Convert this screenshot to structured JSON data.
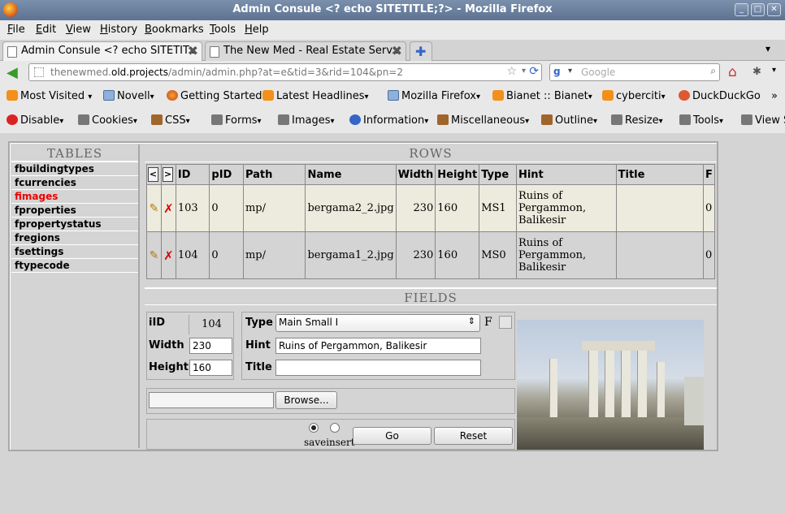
{
  "window": {
    "title": "Admin Consule <? echo SITETITLE;?> - Mozilla Firefox"
  },
  "menu": [
    "File",
    "Edit",
    "View",
    "History",
    "Bookmarks",
    "Tools",
    "Help"
  ],
  "tabs": [
    {
      "label": "Admin Consule <? echo SITETIT..."
    },
    {
      "label": "The New Med - Real Estate Serv..."
    }
  ],
  "nav": {
    "url_prefix": "thenewmed.",
    "url_host": "old.projects",
    "url_rest": "/admin/admin.php?at=e&tid=3&rid=104&pn=2",
    "search_placeholder": "Google"
  },
  "bookmarks": [
    "Most Visited",
    "Novell",
    "Getting Started",
    "Latest Headlines",
    "Mozilla Firefox",
    "Bianet :: Bianet",
    "cyberciti",
    "DuckDuckGo"
  ],
  "webdev": [
    "Disable",
    "Cookies",
    "CSS",
    "Forms",
    "Images",
    "Information",
    "Miscellaneous",
    "Outline",
    "Resize",
    "Tools",
    "View S"
  ],
  "tables": {
    "header": "TABLES",
    "items": [
      "fbuildingtypes",
      "fcurrencies",
      "fimages",
      "fproperties",
      "fpropertystatus",
      "fregions",
      "fsettings",
      "ftypecode"
    ],
    "active": "fimages"
  },
  "rows": {
    "header": "ROWS",
    "prev": "<",
    "next": ">",
    "columns": [
      "ID",
      "pID",
      "Path",
      "Name",
      "Width",
      "Height",
      "Type",
      "Hint",
      "Title",
      "F"
    ],
    "data": [
      {
        "id": "103",
        "pid": "0",
        "path": "mp/",
        "name": "bergama2_2.jpg",
        "width": "230",
        "height": "160",
        "type": "MS1",
        "hint_l1": "Ruins of",
        "hint_l2": "Pergammon,",
        "hint_l3": "Balikesir",
        "title": "",
        "f": "0"
      },
      {
        "id": "104",
        "pid": "0",
        "path": "mp/",
        "name": "bergama1_2.jpg",
        "width": "230",
        "height": "160",
        "type": "MS0",
        "hint_l1": "Ruins of",
        "hint_l2": "Pergammon,",
        "hint_l3": "Balikesir",
        "title": "",
        "f": "0"
      }
    ]
  },
  "fields": {
    "header": "FIELDS",
    "iid_label": "iID",
    "iid_value": "104",
    "type_label": "Type",
    "type_value": "Main Small I",
    "f_label": "F",
    "width_label": "Width",
    "width_value": "230",
    "hint_label": "Hint",
    "hint_value": "Ruins of Pergammon, Balikesir",
    "height_label": "Height",
    "height_value": "160",
    "title_label": "Title",
    "title_value": "",
    "browse_label": "Browse...",
    "save_label": "save",
    "insert_label": "insert",
    "go_label": "Go",
    "reset_label": "Reset"
  }
}
